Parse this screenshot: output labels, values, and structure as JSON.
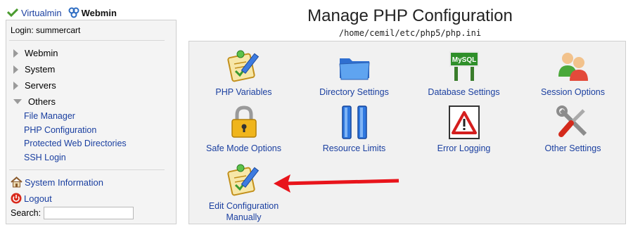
{
  "brand": {
    "virtualmin": "Virtualmin",
    "webmin": "Webmin"
  },
  "sidebar": {
    "login": "Login: summercart",
    "categories": [
      {
        "label": "Webmin",
        "expanded": false
      },
      {
        "label": "System",
        "expanded": false
      },
      {
        "label": "Servers",
        "expanded": false
      },
      {
        "label": "Others",
        "expanded": true
      }
    ],
    "others_items": [
      "File Manager",
      "PHP Configuration",
      "Protected Web Directories",
      "SSH Login"
    ],
    "system_information": "System Information",
    "logout": "Logout",
    "search_label": "Search:",
    "search_value": ""
  },
  "page": {
    "title": "Manage PHP Configuration",
    "subtitle": "/home/cemil/etc/php5/php.ini"
  },
  "tiles": [
    {
      "label": "PHP Variables",
      "icon": "notepad-pencil-icon"
    },
    {
      "label": "Directory Settings",
      "icon": "folder-icon"
    },
    {
      "label": "Database Settings",
      "icon": "mysql-sign-icon",
      "icon_text": "MySQL"
    },
    {
      "label": "Session Options",
      "icon": "users-icon"
    },
    {
      "label": "Safe Mode Options",
      "icon": "padlock-icon"
    },
    {
      "label": "Resource Limits",
      "icon": "pause-bars-icon"
    },
    {
      "label": "Error Logging",
      "icon": "warning-triangle-icon"
    },
    {
      "label": "Other Settings",
      "icon": "tools-icon"
    },
    {
      "label_line1": "Edit Configuration",
      "label_line2": "Manually",
      "icon": "notepad-pencil-icon"
    }
  ],
  "colors": {
    "link": "#1a3fa0",
    "arrow": "#e8141b",
    "panel_bg": "#f1f1f1"
  }
}
